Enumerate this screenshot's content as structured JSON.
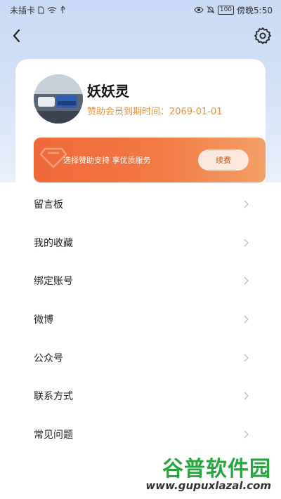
{
  "status_bar": {
    "carrier": "未插卡",
    "battery": "100",
    "time": "傍晚5:50"
  },
  "nav": {
    "back_icon": "chevron-left-icon",
    "settings_icon": "gear-icon"
  },
  "profile": {
    "name": "妖妖灵",
    "membership_text": "赞助会员到期时间：2069-01-01"
  },
  "banner": {
    "text": "选择赞助支持 享优质服务",
    "button": "续费",
    "icon": "diamond-icon"
  },
  "menu": [
    {
      "label": "留言板"
    },
    {
      "label": "我的收藏"
    },
    {
      "label": "绑定账号"
    },
    {
      "label": "微博"
    },
    {
      "label": "公众号"
    },
    {
      "label": "联系方式"
    },
    {
      "label": "常见问题"
    }
  ],
  "watermark": {
    "title": "谷普软件园",
    "url": "www.gupuxlazal.com"
  },
  "colors": {
    "accent_orange": "#f0693a",
    "member_text": "#e8913f",
    "header_bg": "#c9daf6"
  }
}
